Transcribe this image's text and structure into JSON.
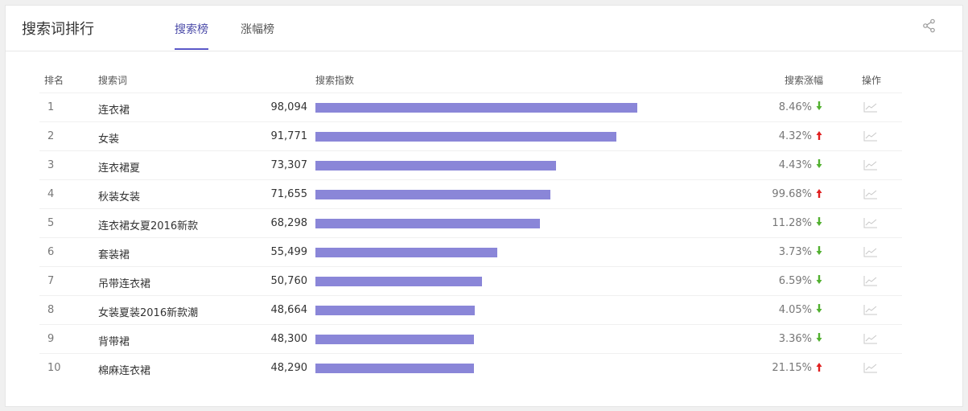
{
  "header": {
    "title": "搜索词排行",
    "tabs": [
      {
        "label": "搜索榜",
        "active": true
      },
      {
        "label": "涨幅榜",
        "active": false
      }
    ],
    "share_icon": "share-icon"
  },
  "table": {
    "columns": {
      "rank": "排名",
      "keyword": "搜索词",
      "index": "搜索指数",
      "growth": "搜索涨幅",
      "action": "操作"
    },
    "rows": [
      {
        "rank": "1",
        "keyword": "连衣裙",
        "index": "98,094",
        "value": 98094,
        "growth": "8.46%",
        "direction": "down"
      },
      {
        "rank": "2",
        "keyword": "女装",
        "index": "91,771",
        "value": 91771,
        "growth": "4.32%",
        "direction": "up"
      },
      {
        "rank": "3",
        "keyword": "连衣裙夏",
        "index": "73,307",
        "value": 73307,
        "growth": "4.43%",
        "direction": "down"
      },
      {
        "rank": "4",
        "keyword": "秋装女装",
        "index": "71,655",
        "value": 71655,
        "growth": "99.68%",
        "direction": "up"
      },
      {
        "rank": "5",
        "keyword": "连衣裙女夏2016新款",
        "index": "68,298",
        "value": 68298,
        "growth": "11.28%",
        "direction": "down"
      },
      {
        "rank": "6",
        "keyword": "套装裙",
        "index": "55,499",
        "value": 55499,
        "growth": "3.73%",
        "direction": "down"
      },
      {
        "rank": "7",
        "keyword": "吊带连衣裙",
        "index": "50,760",
        "value": 50760,
        "growth": "6.59%",
        "direction": "down"
      },
      {
        "rank": "8",
        "keyword": "女装夏装2016新款潮",
        "index": "48,664",
        "value": 48664,
        "growth": "4.05%",
        "direction": "down"
      },
      {
        "rank": "9",
        "keyword": "背带裙",
        "index": "48,300",
        "value": 48300,
        "growth": "3.36%",
        "direction": "down"
      },
      {
        "rank": "10",
        "keyword": "棉麻连衣裙",
        "index": "48,290",
        "value": 48290,
        "growth": "21.15%",
        "direction": "up"
      }
    ],
    "trend_icon": "trend-chart-icon"
  },
  "colors": {
    "bar": "#8a86d8",
    "up": "#e02020",
    "down": "#52b030",
    "tab_active": "#4a4aa8"
  }
}
